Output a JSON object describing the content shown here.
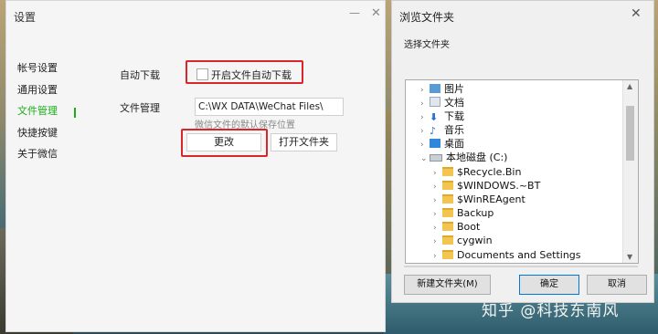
{
  "settings_window": {
    "title": "设置",
    "min_glyph": "—",
    "close_glyph": "✕",
    "sidebar": [
      {
        "label": "帐号设置",
        "active": false
      },
      {
        "label": "通用设置",
        "active": false
      },
      {
        "label": "文件管理",
        "active": true
      },
      {
        "label": "快捷按键",
        "active": false
      },
      {
        "label": "关于微信",
        "active": false
      }
    ],
    "auto_download_label": "自动下载",
    "auto_download_checkbox_label": "开启文件自动下载",
    "auto_download_checked": false,
    "file_management_label": "文件管理",
    "path_value": "C:\\WX DATA\\WeChat Files\\",
    "path_hint": "微信文件的默认保存位置",
    "change_button": "更改",
    "open_folder_button": "打开文件夹",
    "accent_color": "#1aad19",
    "highlight_color": "#d9252b"
  },
  "browse_dialog": {
    "title": "浏览文件夹",
    "close_glyph": "✕",
    "subtitle": "选择文件夹",
    "tree": [
      {
        "label": "图片",
        "icon": "pictures-icon",
        "expand": "collapsed"
      },
      {
        "label": "文档",
        "icon": "documents-icon",
        "expand": "collapsed"
      },
      {
        "label": "下载",
        "icon": "download-icon",
        "expand": "collapsed"
      },
      {
        "label": "音乐",
        "icon": "music-icon",
        "expand": "collapsed"
      },
      {
        "label": "桌面",
        "icon": "desktop-icon",
        "expand": "collapsed"
      },
      {
        "label": "本地磁盘 (C:)",
        "icon": "drive-icon",
        "expand": "expanded"
      },
      {
        "label": "$Recycle.Bin",
        "icon": "folder-icon",
        "expand": "collapsed"
      },
      {
        "label": "$WINDOWS.~BT",
        "icon": "folder-icon",
        "expand": "collapsed"
      },
      {
        "label": "$WinREAgent",
        "icon": "folder-icon",
        "expand": "collapsed"
      },
      {
        "label": "Backup",
        "icon": "folder-icon",
        "expand": "collapsed"
      },
      {
        "label": "Boot",
        "icon": "folder-icon",
        "expand": "collapsed"
      },
      {
        "label": "cygwin",
        "icon": "folder-icon",
        "expand": "collapsed"
      },
      {
        "label": "Documents and Settings",
        "icon": "folder-icon",
        "expand": "collapsed"
      }
    ],
    "new_folder_button": "新建文件夹(M)",
    "ok_button": "确定",
    "cancel_button": "取消"
  },
  "watermark": "知乎 @科技东南风"
}
